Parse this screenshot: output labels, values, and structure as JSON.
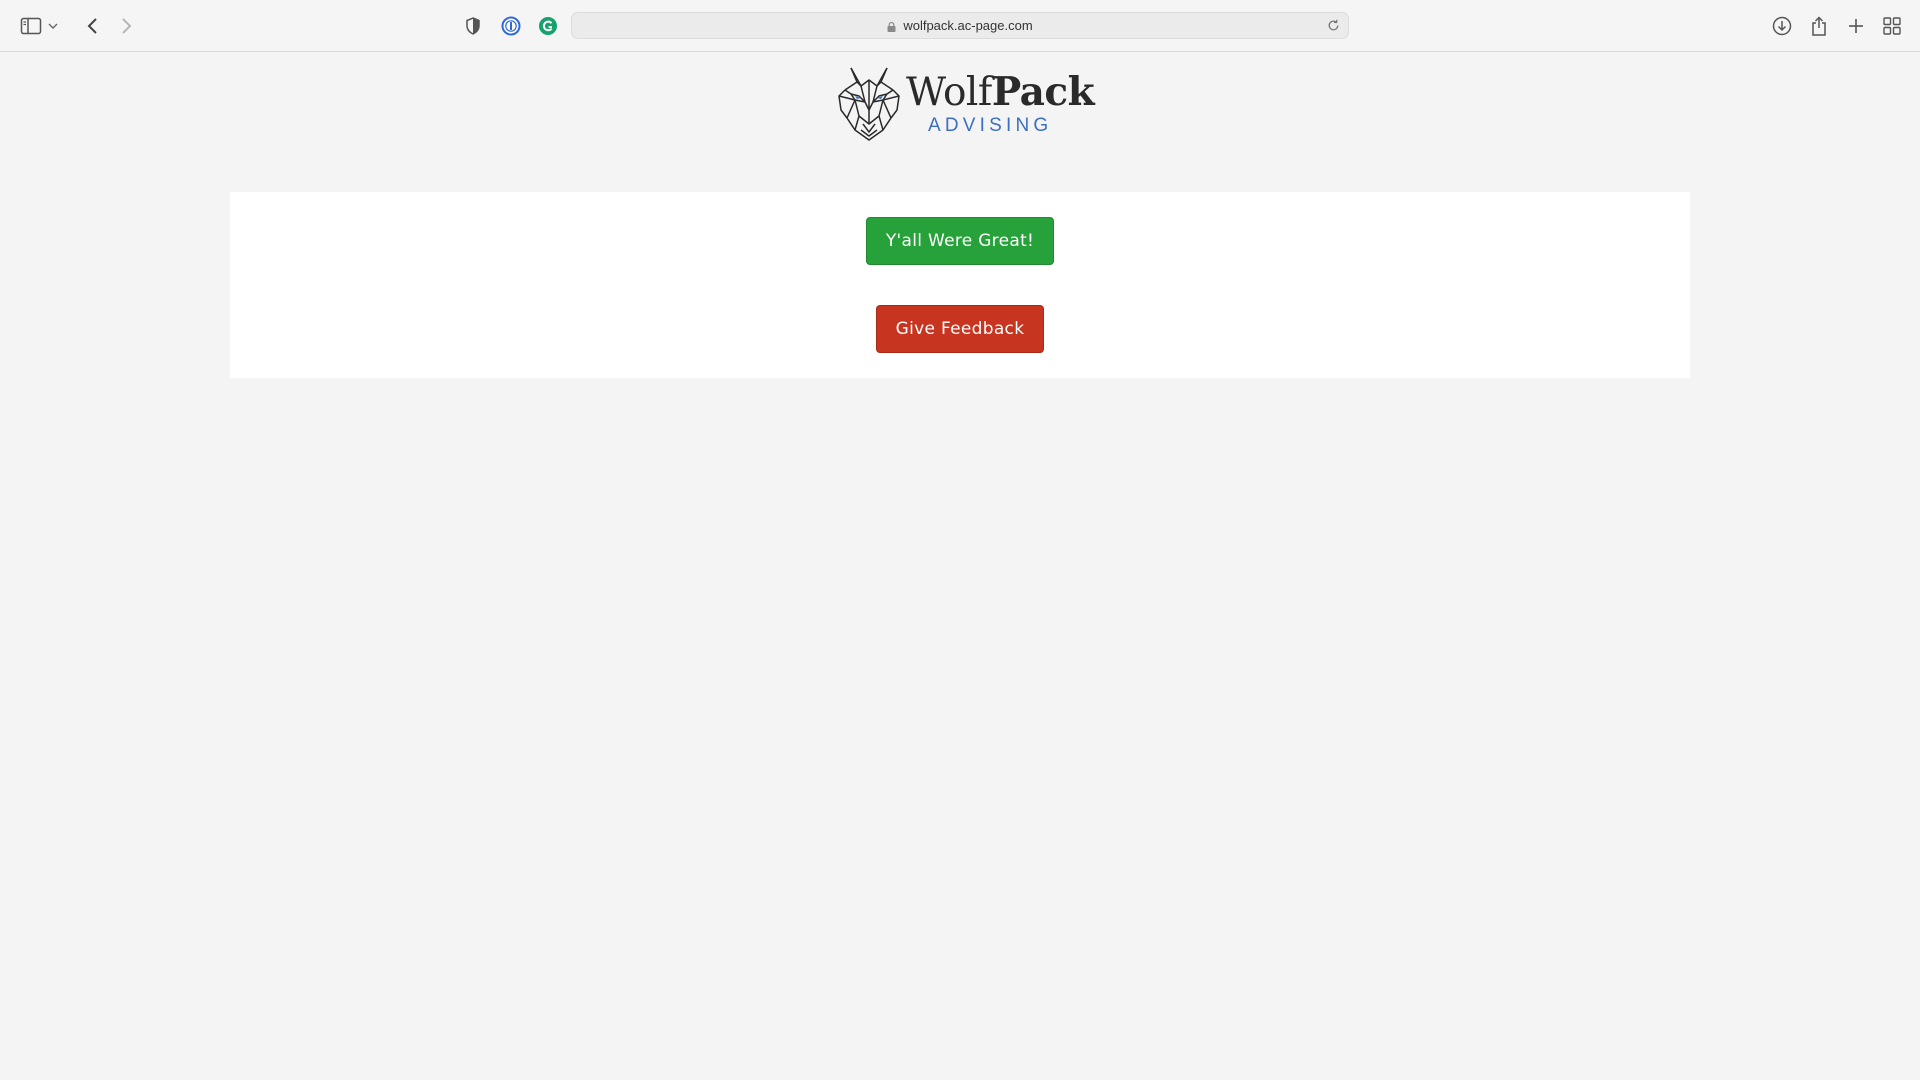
{
  "browser": {
    "url": "wolfpack.ac-page.com",
    "icons": {
      "sidebar": "sidebar-toggle-icon",
      "chevron": "chevron-down-icon",
      "back": "back-arrow-icon",
      "forward": "forward-arrow-icon",
      "shield": "privacy-shield-icon",
      "password": "password-manager-icon",
      "grammarly": "grammar-extension-icon",
      "lock": "lock-icon",
      "reload": "reload-icon",
      "download": "download-icon",
      "share": "share-icon",
      "newtab": "plus-icon",
      "tabs": "tab-overview-icon"
    }
  },
  "logo": {
    "word_regular": "Wolf",
    "word_bold": "Pack",
    "subtitle": "ADVISING",
    "colors": {
      "text": "#2a2a2a",
      "subtitle": "#3c6fc2"
    }
  },
  "actions": {
    "great_label": "Y'all Were Great!",
    "feedback_label": "Give Feedback",
    "colors": {
      "great": "#27a23a",
      "feedback": "#c7341f"
    }
  }
}
